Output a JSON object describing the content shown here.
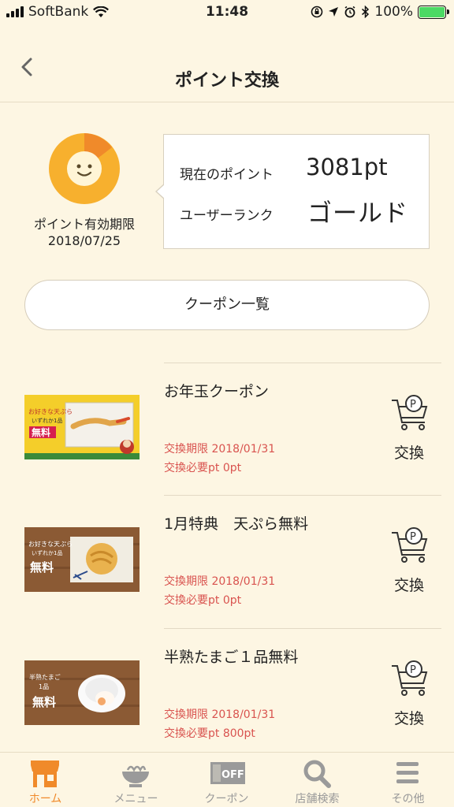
{
  "status_bar": {
    "carrier": "SoftBank",
    "time": "11:48",
    "battery": "100%"
  },
  "header": {
    "title": "ポイント交換"
  },
  "points": {
    "expiry_label": "ポイント有効期限",
    "expiry_date": "2018/07/25",
    "current_label": "現在のポイント",
    "current_value": "3081pt",
    "rank_label": "ユーザーランク",
    "rank_value": "ゴールド"
  },
  "coupon_list_button": "クーポン一覧",
  "coupons": [
    {
      "title": "お年玉クーポン",
      "limit": "交換期限 2018/01/31",
      "required": "交換必要pt 0pt",
      "action": "交換",
      "thumb_text1": "お好きな天ぷら",
      "thumb_text2": "いずれか1品",
      "thumb_text3": "無料"
    },
    {
      "title": "1月特典　天ぷら無料",
      "limit": "交換期限 2018/01/31",
      "required": "交換必要pt 0pt",
      "action": "交換",
      "thumb_text1": "お好きな天ぷら",
      "thumb_text2": "いずれか1品",
      "thumb_text3": "無料"
    },
    {
      "title": "半熟たまご１品無料",
      "limit": "交換期限 2018/01/31",
      "required": "交換必要pt 800pt",
      "action": "交換",
      "thumb_text1": "半熟たまご",
      "thumb_text2": "1品",
      "thumb_text3": "無料"
    }
  ],
  "tabs": [
    {
      "label": "ホーム",
      "icon": "shop-icon",
      "active": true
    },
    {
      "label": "メニュー",
      "icon": "bowl-icon"
    },
    {
      "label": "クーポン",
      "icon": "coupon-icon",
      "badge": "OFF"
    },
    {
      "label": "店舗検索",
      "icon": "search-icon"
    },
    {
      "label": "その他",
      "icon": "menu-icon"
    }
  ],
  "colors": {
    "background": "#fdf6e3",
    "accent": "#f08a2a",
    "limit_text": "#d9534f",
    "avatar": "#f5a623"
  }
}
